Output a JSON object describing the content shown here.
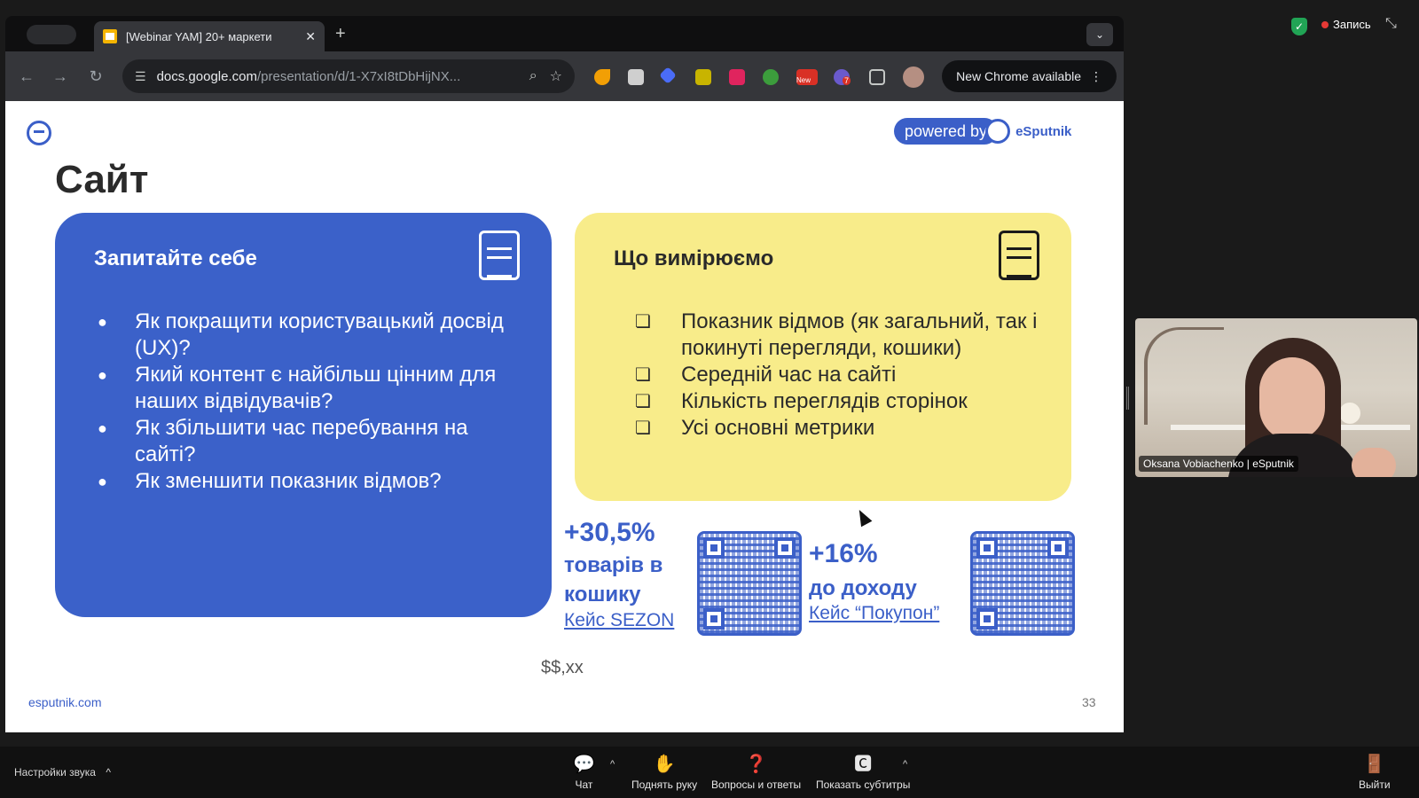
{
  "browser": {
    "tab_title": "[Webinar YAM] 20+ маркети",
    "tab_close": "✕",
    "new_tab": "+",
    "tab_menu": "⌄",
    "url_host": "docs.google.com",
    "url_path": "/presentation/d/1-X7xI8tDbHijNX...",
    "new_chrome_label": "New Chrome available",
    "back_icon": "←",
    "forward_icon": "→",
    "reload_icon": "↻",
    "zoom_icon": "⌕",
    "star_icon": "☆",
    "kebab_icon": "⋮",
    "ext_new_badge": "New",
    "ext_count_badge": "7"
  },
  "slide": {
    "powered_by": "powered by",
    "brand": "eSputnik",
    "title": "Сайт",
    "left_card": {
      "heading": "Запитайте себе",
      "items": [
        "Як покращити користувацький досвід (UX)?",
        "Який контент є найбільш цінним для наших відвідувачів?",
        "Як збільшити час перебування на сайті?",
        "Як зменшити показник відмов?"
      ]
    },
    "right_card": {
      "heading": "Що вимірюємо",
      "items": [
        "Показник відмов (як загальний, так і покинуті перегляди, кошики)",
        "Середній час на сайті",
        "Кількість переглядів сторінок",
        "Усі основні метрики"
      ]
    },
    "stat1": {
      "value": "+30,5%",
      "line1": "товарів в",
      "line2": "кошику",
      "link": "Кейс SEZON"
    },
    "stat2": {
      "value": "+16%",
      "line1": "до доходу",
      "link": "Кейс “Покупон”"
    },
    "price": "$$,xx",
    "footer_site": "esputnik.com",
    "page_number": "33",
    "accent_color": "#3b61c9",
    "yellow_color": "#f8ec8a"
  },
  "meeting": {
    "record_label": "Запись",
    "participant_name": "Oksana Vobiachenko | eSputnik",
    "audio_settings": "Настройки звука",
    "caret": "^",
    "chat": "Чат",
    "raise_hand": "Поднять руку",
    "qa": "Вопросы и ответы",
    "subtitles": "Показать субтитры",
    "exit": "Выйти"
  }
}
